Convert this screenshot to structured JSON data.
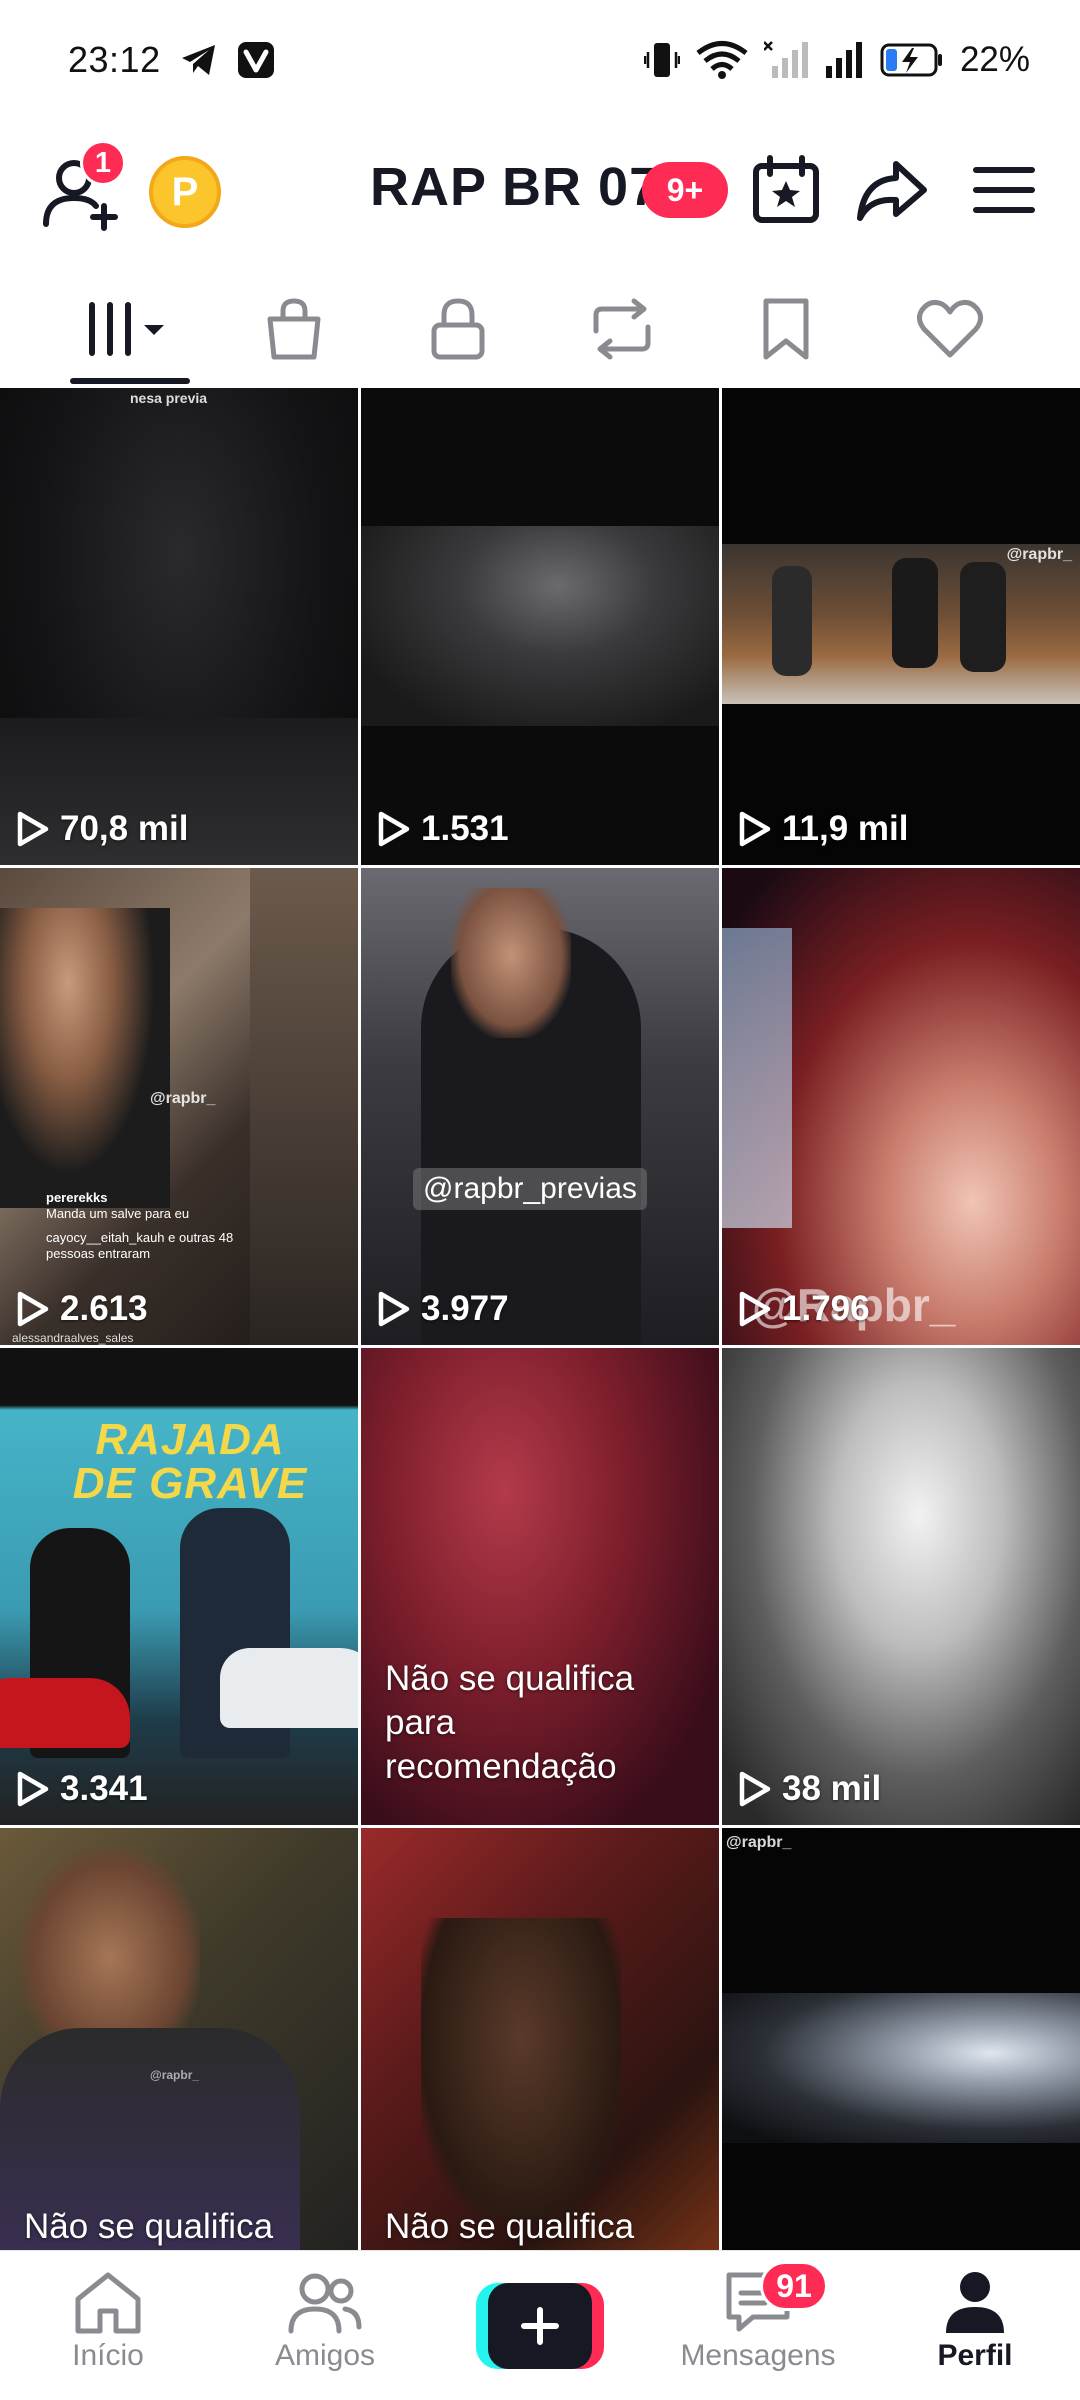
{
  "status_bar": {
    "time": "23:12",
    "battery": "22%",
    "icons": [
      "telegram-icon",
      "vivaldi-icon",
      "vibrate-icon",
      "wifi-icon",
      "signal-x-icon",
      "signal-icon",
      "battery-charging-icon"
    ]
  },
  "header": {
    "title": "RAP BR 07",
    "title_badge": "9+",
    "friend_badge": "1",
    "coin_letter": "P",
    "icons": [
      "add-friend-icon",
      "coin-icon",
      "calendar-star-icon",
      "share-icon",
      "menu-icon"
    ]
  },
  "tabs": [
    {
      "name": "videos",
      "icon": "grid-columns-icon",
      "active": true
    },
    {
      "name": "shop",
      "icon": "shopping-bag-icon"
    },
    {
      "name": "private",
      "icon": "lock-icon"
    },
    {
      "name": "reposts",
      "icon": "repost-icon"
    },
    {
      "name": "favorites",
      "icon": "bookmark-icon"
    },
    {
      "name": "liked",
      "icon": "heart-icon"
    }
  ],
  "videos": [
    {
      "views": "70,8 mil",
      "overlay": "nesa previa"
    },
    {
      "views": "1.531"
    },
    {
      "views": "11,9 mil",
      "overlay": "@rapbr_"
    },
    {
      "views": "2.613",
      "overlay": "@rapbr_",
      "comments": [
        "pererekks",
        "Manda um salve para eu",
        "cayocy__eitah_kauh e outras 48 pessoas entraram",
        "alessandraalves_sales"
      ]
    },
    {
      "views": "3.977",
      "overlay": "@rapbr_previas"
    },
    {
      "views": "1.796",
      "overlay": "@Rapbr_"
    },
    {
      "views": "3.341",
      "overlay": "RAJADA DE GRAVE"
    },
    {
      "note": "Não se qualifica para recomendação"
    },
    {
      "views": "38 mil"
    },
    {
      "note": "Não se qualifica para recomendação",
      "overlay": "@rapbr_"
    },
    {
      "note": "Não se qualifica para recomendação"
    },
    {
      "overlay": "@rapbr_"
    }
  ],
  "bottom_nav": {
    "home": "Início",
    "friends": "Amigos",
    "messages": "Mensagens",
    "messages_badge": "91",
    "profile": "Perfil"
  },
  "colors": {
    "accent": "#fe2c55",
    "cyan": "#25f4ee",
    "coin": "#fbc62b",
    "text": "#161823",
    "muted": "#8a8b91"
  }
}
